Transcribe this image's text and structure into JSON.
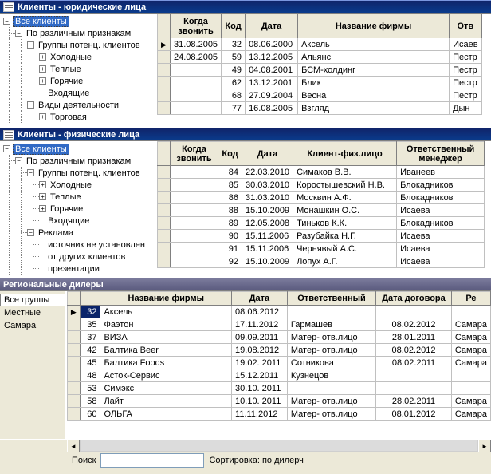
{
  "panel1": {
    "title": "Клиенты - юридические лица",
    "tree": {
      "root": "Все клиенты",
      "l1": "По различным признакам",
      "l2": "Группы потенц. клиентов",
      "items": [
        "Холодные",
        "Теплые",
        "Горячие",
        "Входящие"
      ],
      "l2b": "Виды деятельности",
      "l2b_item": "Торговая"
    },
    "headers": {
      "when": "Когда звонить",
      "code": "Код",
      "date": "Дата",
      "firm": "Название фирмы",
      "resp": "Отв"
    },
    "rows": [
      {
        "when": "31.08.2005",
        "code": "32",
        "date": "08.06.2000",
        "firm": "Аксель",
        "resp": "Исаев"
      },
      {
        "when": "24.08.2005",
        "code": "59",
        "date": "13.12.2005",
        "firm": "Альянс",
        "resp": "Пестр"
      },
      {
        "when": "",
        "code": "49",
        "date": "04.08.2001",
        "firm": "БСМ-холдинг",
        "resp": "Пестр"
      },
      {
        "when": "",
        "code": "62",
        "date": "13.12.2001",
        "firm": "Блик",
        "resp": "Пестр"
      },
      {
        "when": "",
        "code": "68",
        "date": "27.09.2004",
        "firm": "Весна",
        "resp": "Пестр"
      },
      {
        "when": "",
        "code": "77",
        "date": "16.08.2005",
        "firm": "Взгляд",
        "resp": "Дын"
      }
    ]
  },
  "panel2": {
    "title": "Клиенты - физические лица",
    "tree": {
      "root": "Все клиенты",
      "l1": "По различным признакам",
      "l2": "Группы потенц. клиентов",
      "items": [
        "Холодные",
        "Теплые",
        "Горячие",
        "Входящие"
      ],
      "l2b": "Реклама",
      "l2b_items": [
        "источник не установлен",
        "от других клиентов",
        "презентации"
      ]
    },
    "headers": {
      "when": "Когда звонить",
      "code": "Код",
      "date": "Дата",
      "person": "Клиент-физ.лицо",
      "manager": "Ответственный менеджер"
    },
    "rows": [
      {
        "when": "",
        "code": "84",
        "date": "22.03.2010",
        "person": "Симаков В.В.",
        "manager": "Иванеев"
      },
      {
        "when": "",
        "code": "85",
        "date": "30.03.2010",
        "person": "Коростышевский Н.В.",
        "manager": "Блокадников"
      },
      {
        "when": "",
        "code": "86",
        "date": "31.03.2010",
        "person": "Москвин А.Ф.",
        "manager": "Блокадников"
      },
      {
        "when": "",
        "code": "88",
        "date": "15.10.2009",
        "person": "Монашкин О.С.",
        "manager": "Исаева"
      },
      {
        "when": "",
        "code": "89",
        "date": "12.05.2008",
        "person": "Тиньков К.К.",
        "manager": "Блокадников"
      },
      {
        "when": "",
        "code": "90",
        "date": "15.11.2006",
        "person": "Разубайка Н.Г.",
        "manager": "Исаева"
      },
      {
        "when": "",
        "code": "91",
        "date": "15.11.2006",
        "person": "Чернявый А.С.",
        "manager": "Исаева"
      },
      {
        "when": "",
        "code": "92",
        "date": "15.10.2009",
        "person": "Лопух А.Г.",
        "manager": "Исаева"
      }
    ]
  },
  "panel3": {
    "title": "Региональные дилеры",
    "tabs": [
      "Все группы",
      "Местные",
      "Самара"
    ],
    "headers": {
      "firm": "Название фирмы",
      "date": "Дата",
      "resp": "Ответственный",
      "contract": "Дата договора",
      "reg": "Ре"
    },
    "rows": [
      {
        "code": "32",
        "firm": "Аксель",
        "date": "08.06.2012",
        "resp": "",
        "contract": "",
        "reg": ""
      },
      {
        "code": "35",
        "firm": "Фаэтон",
        "date": "17.11.2012",
        "resp": "Гармашев",
        "contract": "08.02.2012",
        "reg": "Самара"
      },
      {
        "code": "37",
        "firm": "ВИЗА",
        "date": "09.09.2011",
        "resp": "Матер- отв.лицо",
        "contract": "28.01.2011",
        "reg": "Самара"
      },
      {
        "code": "42",
        "firm": "Балтика Beer",
        "date": "19.08.2012",
        "resp": "Матер- отв.лицо",
        "contract": "08.02.2012",
        "reg": "Самара"
      },
      {
        "code": "45",
        "firm": "Балтика Foods",
        "date": "19.02. 2011",
        "resp": "Сотникова",
        "contract": "08.02.2011",
        "reg": "Самара"
      },
      {
        "code": "48",
        "firm": "Асток-Сервис",
        "date": "15.12.2011",
        "resp": "Кузнецов",
        "contract": "",
        "reg": ""
      },
      {
        "code": "53",
        "firm": "Симэкс",
        "date": "30.10. 2011",
        "resp": "",
        "contract": "",
        "reg": ""
      },
      {
        "code": "58",
        "firm": "Лайт",
        "date": "10.10. 2011",
        "resp": "Матер- отв.лицо",
        "contract": "28.02.2011",
        "reg": "Самара"
      },
      {
        "code": "60",
        "firm": "ОЛЬГА",
        "date": "11.11.2012",
        "resp": "Матер- отв.лицо",
        "contract": "08.01.2012",
        "reg": "Самара"
      }
    ]
  },
  "footer": {
    "search_label": "Поиск",
    "sort_label": "Сортировка: по дилерч",
    "search_value": ""
  }
}
